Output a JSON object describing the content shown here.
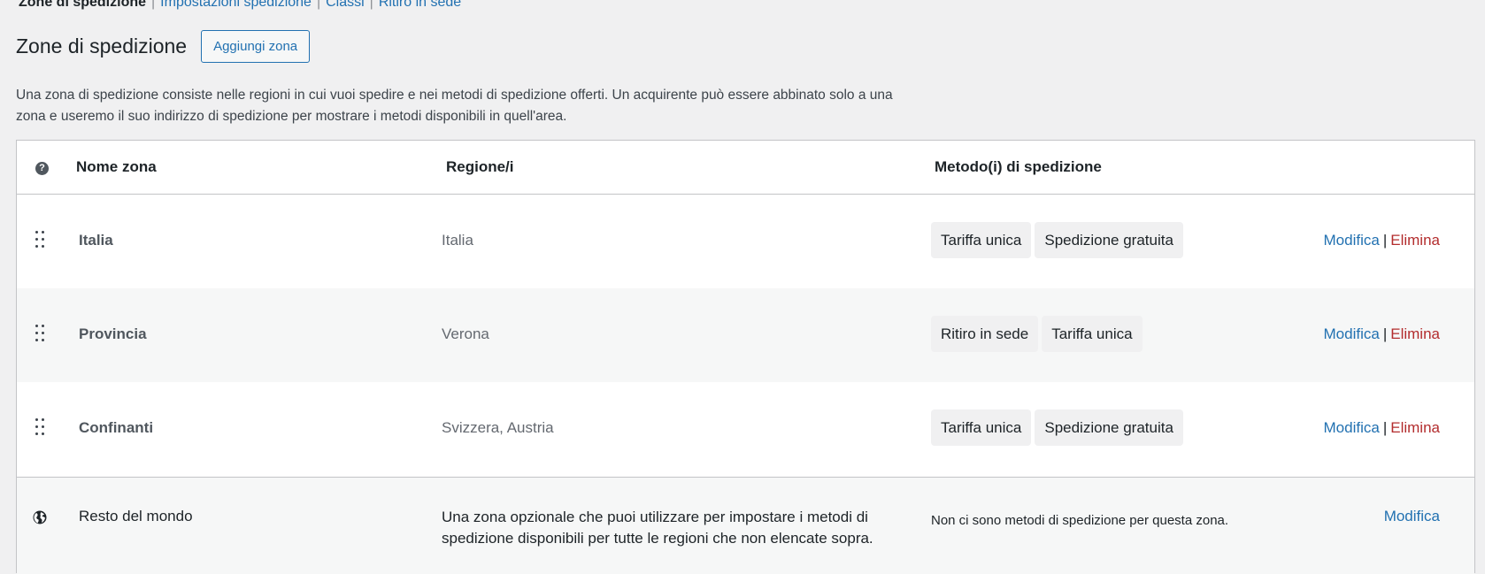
{
  "subnav": {
    "current": "Zone di spedizione",
    "links": [
      "Impostazioni spedizione",
      "Classi",
      "Ritiro in sede"
    ],
    "separator": "|"
  },
  "page": {
    "title": "Zone di spedizione",
    "add_zone_label": "Aggiungi zona",
    "intro": "Una zona di spedizione consiste nelle regioni in cui vuoi spedire e nei metodi di spedizione offerti. Un acquirente può essere abbinato solo a una zona e useremo il suo indirizzo di spedizione per mostrare i metodi disponibili in quell'area."
  },
  "table": {
    "headers": {
      "help_icon": "?",
      "name": "Nome zona",
      "region": "Regione/i",
      "methods": "Metodo(i) di spedizione"
    },
    "rows": [
      {
        "name": "Italia",
        "region": "Italia",
        "methods": [
          "Tariffa unica",
          "Spedizione gratuita"
        ],
        "edit": "Modifica",
        "sep": "|",
        "delete": "Elimina"
      },
      {
        "name": "Provincia",
        "region": "Verona",
        "methods": [
          "Ritiro in sede",
          "Tariffa unica"
        ],
        "edit": "Modifica",
        "sep": "|",
        "delete": "Elimina"
      },
      {
        "name": "Confinanti",
        "region": "Svizzera, Austria",
        "methods": [
          "Tariffa unica",
          "Spedizione gratuita"
        ],
        "edit": "Modifica",
        "sep": "|",
        "delete": "Elimina"
      }
    ],
    "rest": {
      "icon": "globe-icon",
      "name": "Resto del mondo",
      "description": "Una zona opzionale che puoi utilizzare per impostare i metodi di spedizione disponibili per tutte le regioni che non elencate sopra.",
      "methods_text": "Non ci sono metodi di spedizione per questa zona.",
      "edit": "Modifica"
    }
  },
  "colors": {
    "link": "#2271b1",
    "delete": "#b32d2e",
    "background": "#f0f0f1"
  }
}
